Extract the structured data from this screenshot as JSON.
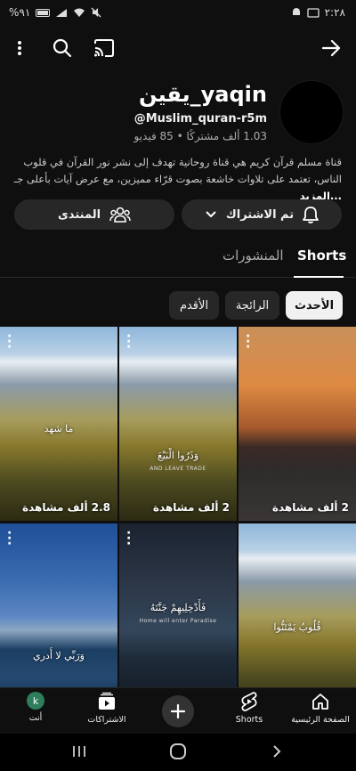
{
  "status_bar": {
    "time": "٢:٢٨",
    "battery": "%٩١"
  },
  "channel": {
    "name": "يقين_yaqin",
    "handle": "@Muslim_quran-r5m",
    "stats": "1.03 ألف مشتركًا • 85 فيديو",
    "description": "قناة مسلم قرآن كريم هي قناة روحانية تهدف إلى نشر نور القرآن في قلوب الناس، تعتمد على تلاوات خاشعة بصوت قرّاء مميزين، مع عرض آيات بأعلى جـ",
    "more_label": "...المزيد"
  },
  "buttons": {
    "subscribed": "تم الاشتراك",
    "community": "المنتدى"
  },
  "tabs": [
    {
      "label": "Shorts",
      "active": true
    },
    {
      "label": "المنشورات",
      "active": false
    }
  ],
  "chips": [
    {
      "label": "الأحدث",
      "active": true
    },
    {
      "label": "الرائجة",
      "active": false
    },
    {
      "label": "الأقدم",
      "active": false
    }
  ],
  "shorts": [
    {
      "views": "2.8 ألف مشاهدة",
      "caption": "ما شهد",
      "subcaption": "",
      "scene": "mountain"
    },
    {
      "views": "2 ألف مشاهدة",
      "caption": "وَذَرُوا الْبَيْعَ",
      "subcaption": "AND LEAVE TRADE",
      "scene": "mountain"
    },
    {
      "views": "2 ألف مشاهدة",
      "caption": "",
      "subcaption": "",
      "scene": "city"
    },
    {
      "views": "",
      "caption": "وَرَبِّي لا أَدري",
      "subcaption": "",
      "scene": "lake"
    },
    {
      "views": "",
      "caption": "فَأَدْخِلِيهِمْ جَنَّتَهُ",
      "subcaption": "Home will enter Paradise",
      "scene": "dark"
    },
    {
      "views": "",
      "caption": "قُلُوبٌ يَمْتَنُّوا",
      "subcaption": "",
      "scene": "mountain"
    }
  ],
  "bottom_nav": [
    {
      "label": "الصفحة الرئيسية",
      "icon": "home-icon"
    },
    {
      "label": "Shorts",
      "icon": "shorts-icon"
    },
    {
      "label": "",
      "icon": "plus-icon"
    },
    {
      "label": "الاشتراكات",
      "icon": "subscriptions-icon"
    },
    {
      "label": "أنت",
      "icon": "avatar",
      "avatar_letter": "k"
    }
  ]
}
